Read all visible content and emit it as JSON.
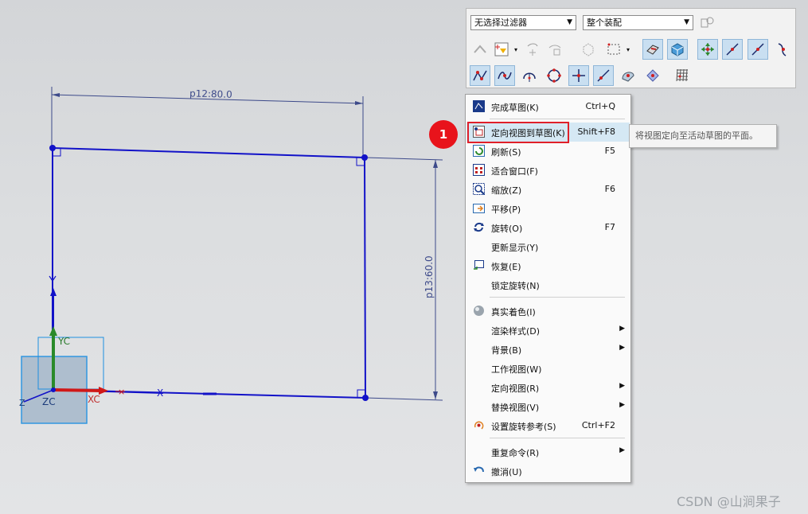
{
  "toolbar": {
    "filter_value": "无选择过滤器",
    "scope_value": "整个装配"
  },
  "sketch": {
    "dim_horizontal": "p12:80.0",
    "dim_vertical": "p13:60.0",
    "axis_yc": "YC",
    "axis_xc": "XC",
    "axis_zc": "ZC",
    "axis_z": "Z",
    "axis_x": "X"
  },
  "menu": {
    "items": [
      {
        "label": "完成草图(K)",
        "shortcut": "Ctrl+Q",
        "icon": "finish-sketch-icon"
      },
      {
        "label": "定向视图到草图(K)",
        "shortcut": "Shift+F8",
        "icon": "orient-view-icon"
      },
      {
        "label": "刷新(S)",
        "shortcut": "F5",
        "icon": "refresh-icon"
      },
      {
        "label": "适合窗口(F)",
        "shortcut": "",
        "icon": "fit-window-icon"
      },
      {
        "label": "缩放(Z)",
        "shortcut": "F6",
        "icon": "zoom-icon"
      },
      {
        "label": "平移(P)",
        "shortcut": "",
        "icon": "pan-icon"
      },
      {
        "label": "旋转(O)",
        "shortcut": "F7",
        "icon": "rotate-icon"
      },
      {
        "label": "更新显示(Y)",
        "shortcut": "",
        "icon": ""
      },
      {
        "label": "恢复(E)",
        "shortcut": "",
        "icon": "restore-icon"
      },
      {
        "label": "锁定旋转(N)",
        "shortcut": "",
        "icon": ""
      },
      {
        "label": "真实着色(I)",
        "shortcut": "",
        "icon": "true-shading-icon"
      },
      {
        "label": "渲染样式(D)",
        "shortcut": "",
        "icon": ""
      },
      {
        "label": "背景(B)",
        "shortcut": "",
        "icon": ""
      },
      {
        "label": "工作视图(W)",
        "shortcut": "",
        "icon": ""
      },
      {
        "label": "定向视图(R)",
        "shortcut": "",
        "icon": ""
      },
      {
        "label": "替换视图(V)",
        "shortcut": "",
        "icon": ""
      },
      {
        "label": "设置旋转参考(S)",
        "shortcut": "Ctrl+F2",
        "icon": "rotate-reference-icon"
      },
      {
        "label": "重复命令(R)",
        "shortcut": "",
        "icon": ""
      },
      {
        "label": "撤消(U)",
        "shortcut": "",
        "icon": "undo-icon"
      }
    ]
  },
  "tooltip": "将视图定向至活动草图的平面。",
  "callout_number": "1",
  "watermark": "CSDN @山涧果子",
  "colors": {
    "sketch_line": "#1212c8",
    "highlight_border": "#e0202a",
    "menu_highlight": "#d5e8f4",
    "callout": "#e8131b"
  }
}
